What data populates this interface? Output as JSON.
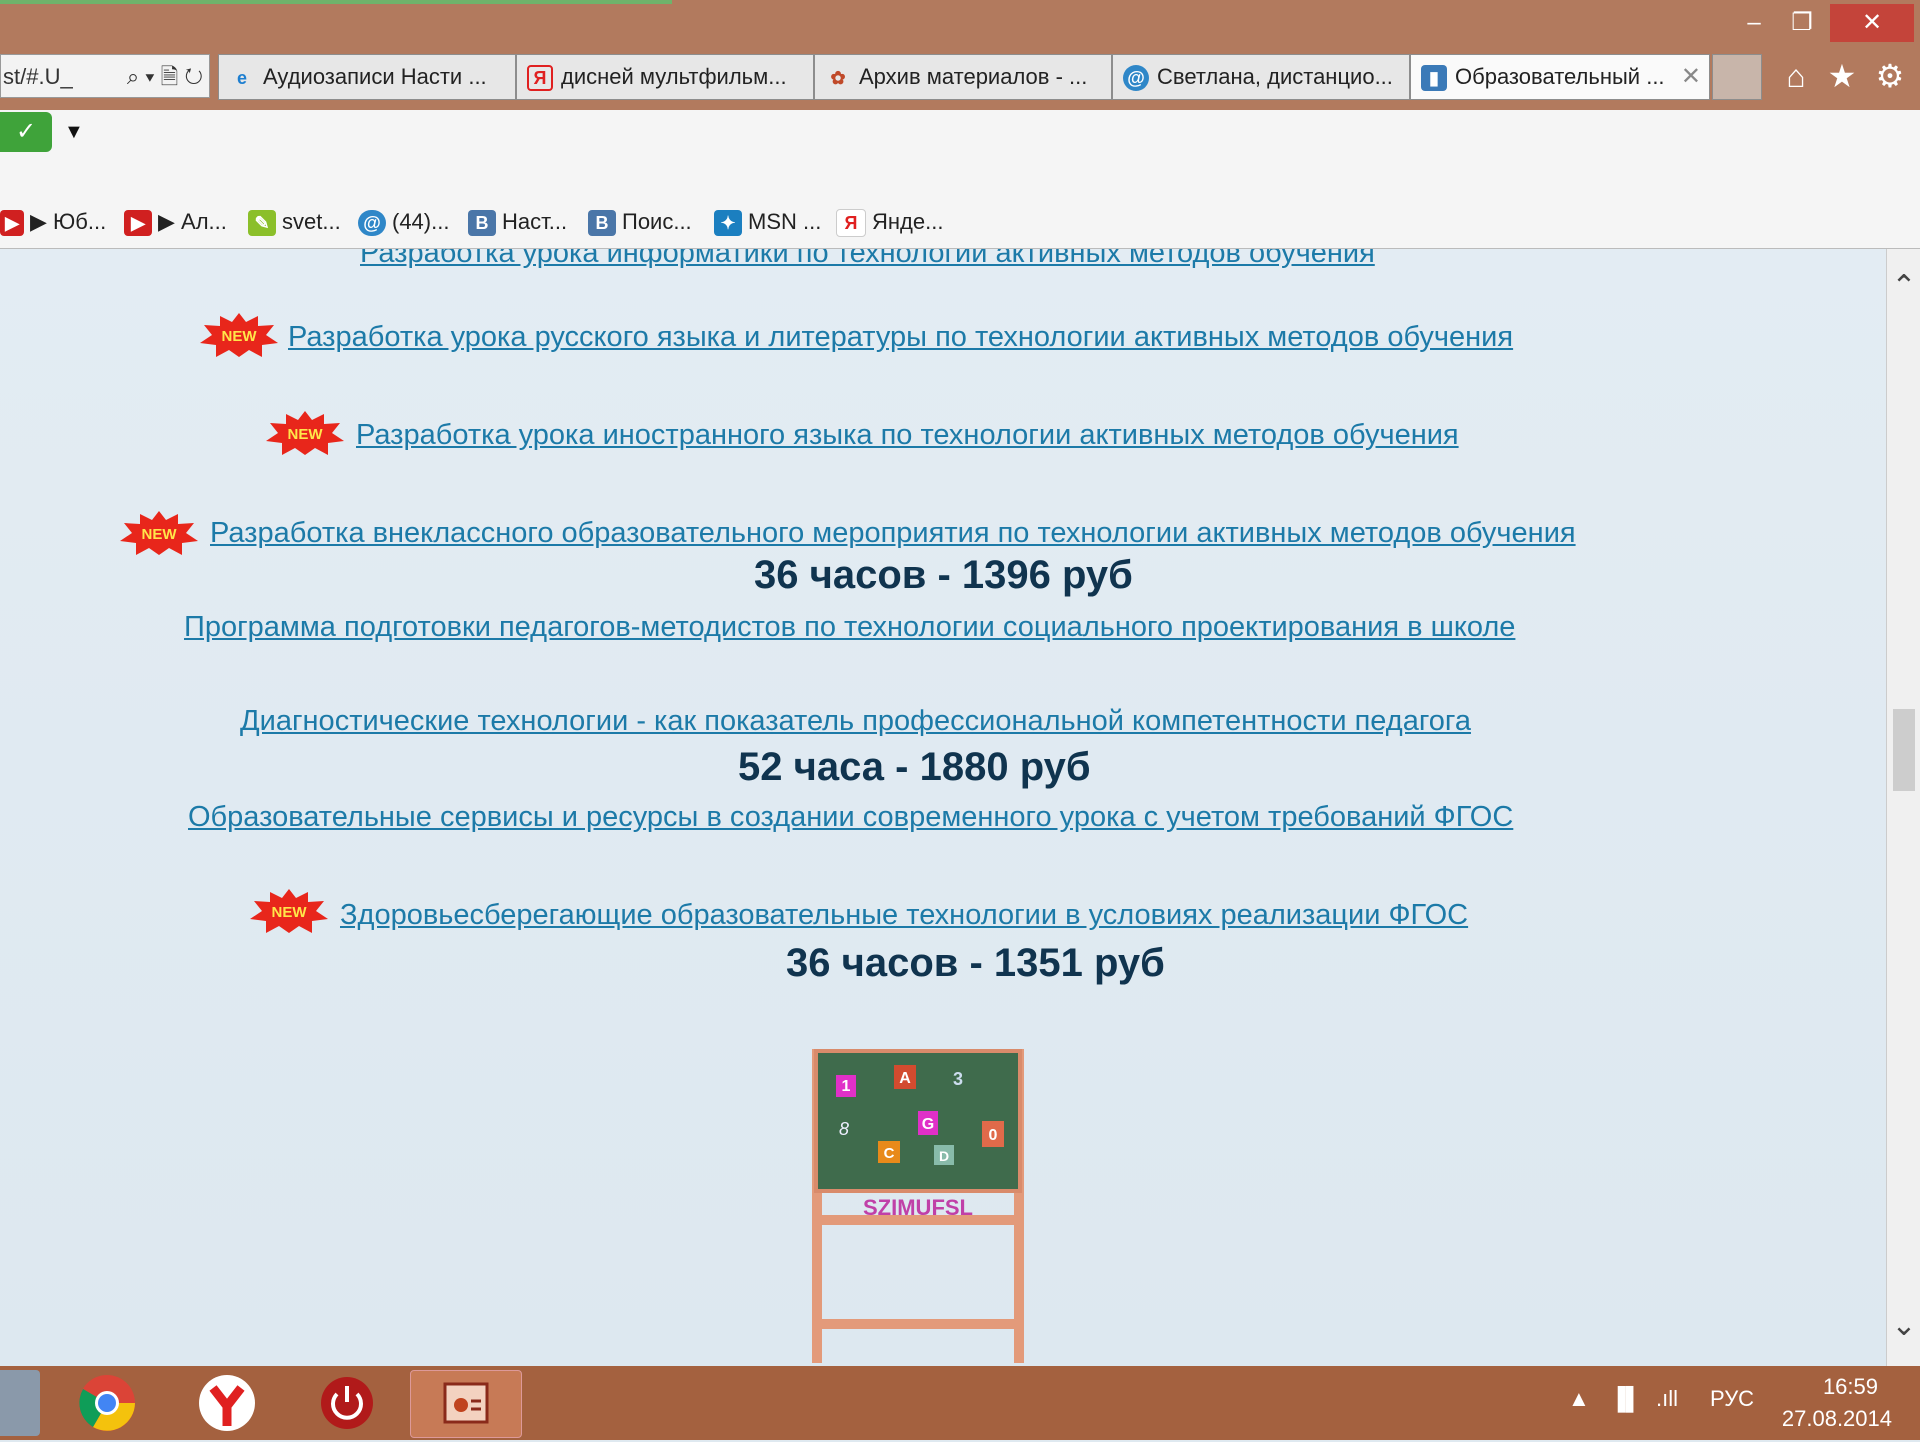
{
  "window": {
    "min_glyph": "–",
    "max_glyph": "❐",
    "close_glyph": "✕"
  },
  "address": {
    "url_fragment": "st/#.U_",
    "tools": "⌕ ▾ 🗎 ↻"
  },
  "tabs": [
    {
      "label": "Аудиозаписи Насти ...",
      "icon": "ie-icon",
      "icon_glyph": "e"
    },
    {
      "label": "дисней мультфильм...",
      "icon": "yandex-icon",
      "icon_glyph": "Я"
    },
    {
      "label": "Архив материалов - ...",
      "icon": "cartoon-icon",
      "icon_glyph": "✿"
    },
    {
      "label": "Светлана, дистанцио...",
      "icon": "mail-icon",
      "icon_glyph": "@"
    },
    {
      "label": "Образовательный ...",
      "icon": "site-icon",
      "icon_glyph": "▮",
      "active": true,
      "close": "✕"
    }
  ],
  "toolbar_icons": {
    "home": "⌂",
    "favorites": "★",
    "settings": "⚙"
  },
  "cmdbar": {
    "ok_glyph": "✓",
    "dropdown_glyph": "▼"
  },
  "favorites": [
    {
      "label": "Юб...",
      "icon": "youtube-icon",
      "prefix": "▶"
    },
    {
      "label": "Ал...",
      "icon": "youtube-icon",
      "prefix": "▶"
    },
    {
      "label": "svet...",
      "icon": "leaf-icon",
      "prefix": ""
    },
    {
      "label": "(44)...",
      "icon": "mail-icon",
      "prefix": ""
    },
    {
      "label": "Наст...",
      "icon": "vk-icon",
      "prefix": ""
    },
    {
      "label": "Поис...",
      "icon": "vk-icon",
      "prefix": ""
    },
    {
      "label": "MSN ...",
      "icon": "msn-icon",
      "prefix": ""
    },
    {
      "label": "Янде...",
      "icon": "yandex-icon",
      "prefix": ""
    }
  ],
  "content": {
    "cut_link": "Разработка урока информатики по технологии активных методов обучения",
    "links": [
      "Разработка урока русского языка и литературы по технологии активных методов обучения",
      "Разработка урока иностранного языка по технологии активных методов обучения",
      "Разработка внеклассного образовательного мероприятия по технологии активных методов обучения",
      "Программа подготовки педагогов-методистов по технологии социального проектирования в школе",
      "Диагностические технологии - как показатель профессиональной компетентности педагога",
      "Образовательные сервисы и ресурсы в создании современного урока с учетом требований ФГОС",
      "Здоровьесберегающие образовательные технологии в условиях реализации ФГОС"
    ],
    "prices": [
      "36 часов - 1396 руб",
      "52 часа - 1880 руб",
      "36 часов - 1351 руб"
    ],
    "new_badge": "NEW",
    "board_letters": [
      "1",
      "A",
      "3",
      "8",
      "G",
      "0",
      "C",
      "D"
    ],
    "board_shelf": "SZIMUFSL"
  },
  "scrollbar": {
    "up": "⌃",
    "down": "⌄"
  },
  "taskbar": {
    "tray_arrow": "▲",
    "tray_network": "▐▌",
    "tray_signal": ".ıll",
    "language": "РУС",
    "time": "16:59",
    "date": "27.08.2014"
  },
  "colors": {
    "link": "#1c7aa8",
    "price": "#10344f",
    "titlebar": "#b27a5e",
    "taskbar": "#a4613f",
    "close_button": "#c4443a"
  }
}
